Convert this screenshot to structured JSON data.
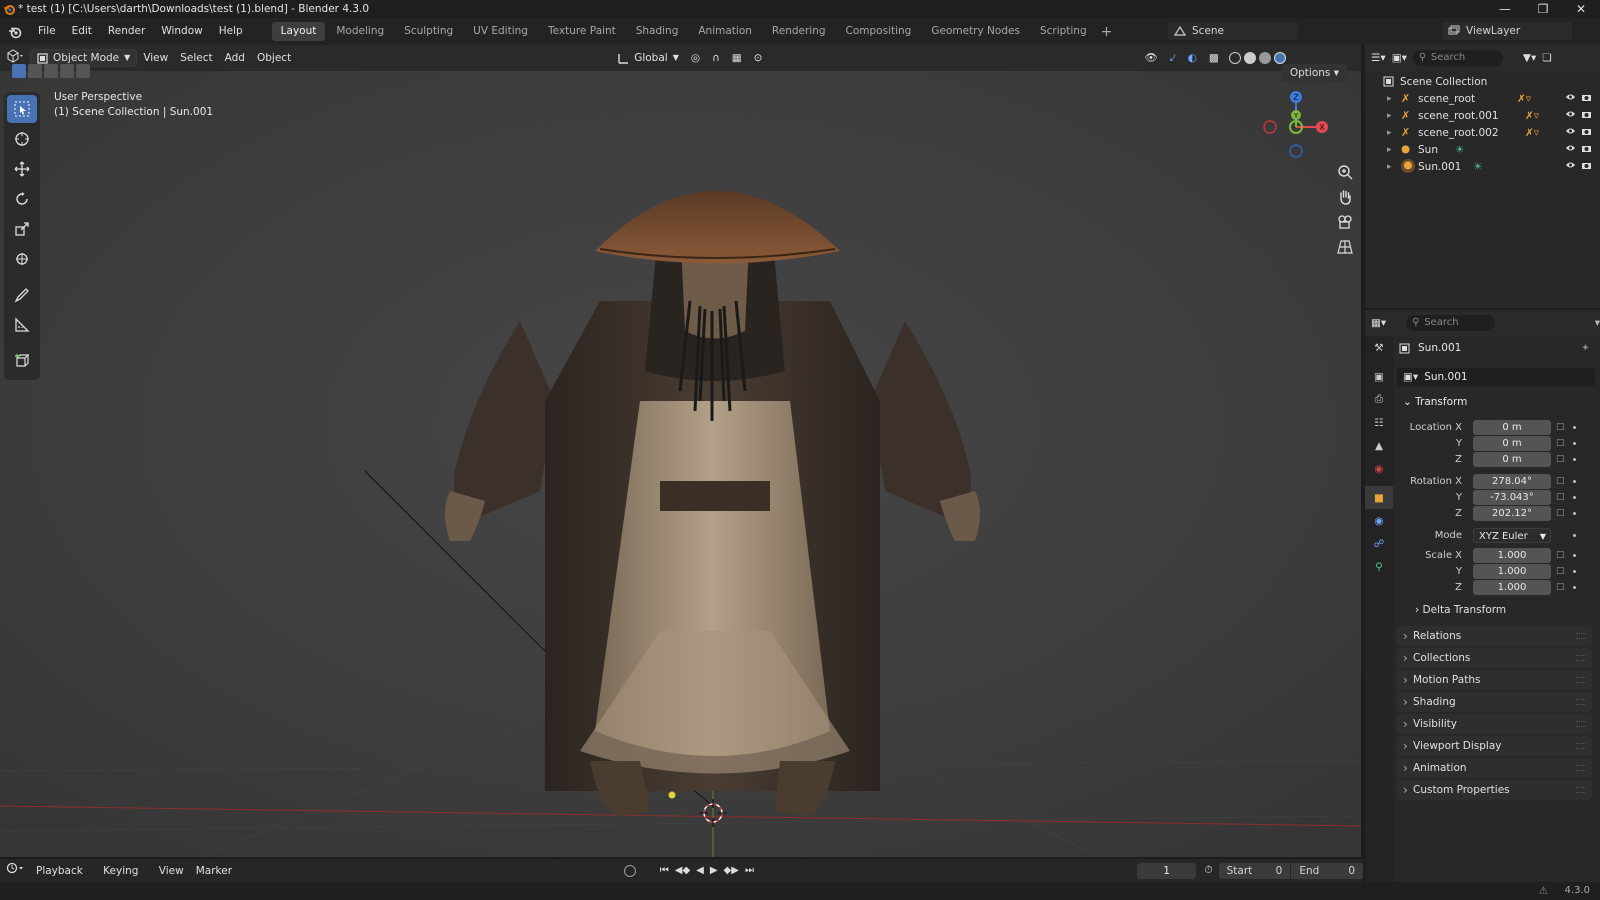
{
  "titlebar": {
    "title": "* test (1) [C:\\Users\\darth\\Downloads\\test (1).blend] - Blender 4.3.0"
  },
  "topbar": {
    "menus": [
      "File",
      "Edit",
      "Render",
      "Window",
      "Help"
    ],
    "tabs": [
      "Layout",
      "Modeling",
      "Sculpting",
      "UV Editing",
      "Texture Paint",
      "Shading",
      "Animation",
      "Rendering",
      "Compositing",
      "Geometry Nodes",
      "Scripting"
    ],
    "active_tab": "Layout",
    "add_tab": "+",
    "scene": "Scene",
    "view_layer": "ViewLayer"
  },
  "viewport": {
    "mode": "Object Mode",
    "menus": [
      "View",
      "Select",
      "Add",
      "Object"
    ],
    "orientation": "Global",
    "options": "Options",
    "info_line1": "User Perspective",
    "info_line2": "(1) Scene Collection | Sun.001",
    "gizmo": {
      "x": "X",
      "y": "Y",
      "z": "Z"
    }
  },
  "timeline": {
    "menus": [
      "Playback",
      "Keying",
      "View",
      "Marker"
    ],
    "current_frame": "1",
    "start_label": "Start",
    "start": "0",
    "end_label": "End",
    "end": "0"
  },
  "statusbar": {
    "version": "4.3.0"
  },
  "outliner": {
    "search_placeholder": "Search",
    "root": "Scene Collection",
    "items": [
      {
        "name": "scene_root",
        "type": "armature"
      },
      {
        "name": "scene_root.001",
        "type": "armature"
      },
      {
        "name": "scene_root.002",
        "type": "armature"
      },
      {
        "name": "Sun",
        "type": "light"
      },
      {
        "name": "Sun.001",
        "type": "light"
      }
    ]
  },
  "properties": {
    "search_placeholder": "Search",
    "object_name": "Sun.001",
    "datablock": "Sun.001",
    "transform_header": "Transform",
    "location_label": "Location X",
    "location": [
      "0 m",
      "0 m",
      "0 m"
    ],
    "rotation_label": "Rotation X",
    "rotation": [
      "278.04°",
      "-73.043°",
      "202.12°"
    ],
    "mode_label": "Mode",
    "mode": "XYZ Euler",
    "scale_label": "Scale X",
    "scale": [
      "1.000",
      "1.000",
      "1.000"
    ],
    "axis_y": "Y",
    "axis_z": "Z",
    "delta": "Delta Transform",
    "panels": [
      "Relations",
      "Collections",
      "Motion Paths",
      "Shading",
      "Visibility",
      "Viewport Display",
      "Animation",
      "Custom Properties"
    ]
  },
  "colors": {
    "accent": "#4772b3",
    "x_axis": "#e5484d",
    "y_axis": "#7cb83a",
    "z_axis": "#3d7be0",
    "light": "#e8a33a"
  }
}
